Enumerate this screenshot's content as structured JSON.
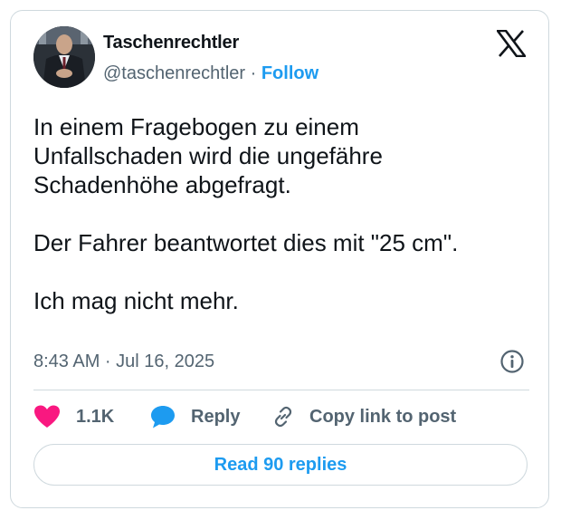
{
  "author": {
    "name": "Taschenrechtler",
    "handle": "@taschenrechtler",
    "separator": "·",
    "follow_label": "Follow"
  },
  "post": {
    "text": "In einem Fragebogen zu einem\nUnfallschaden wird die ungefähre\nSchadenhöhe abgefragt.\n\nDer Fahrer beantwortet dies mit \"25 cm\".\n\nIch mag nicht mehr.",
    "timestamp": "8:43 AM · Jul 16, 2025"
  },
  "actions": {
    "like_count": "1.1K",
    "reply_label": "Reply",
    "copy_link_label": "Copy link to post"
  },
  "footer": {
    "read_replies_label": "Read 90 replies"
  },
  "colors": {
    "accent": "#1d9bf0",
    "like": "#f91880",
    "text": "#0f1419",
    "muted": "#536471",
    "border": "#cfd9de"
  },
  "icons": [
    "x-logo-icon",
    "info-icon",
    "heart-icon",
    "reply-bubble-icon",
    "link-icon"
  ]
}
